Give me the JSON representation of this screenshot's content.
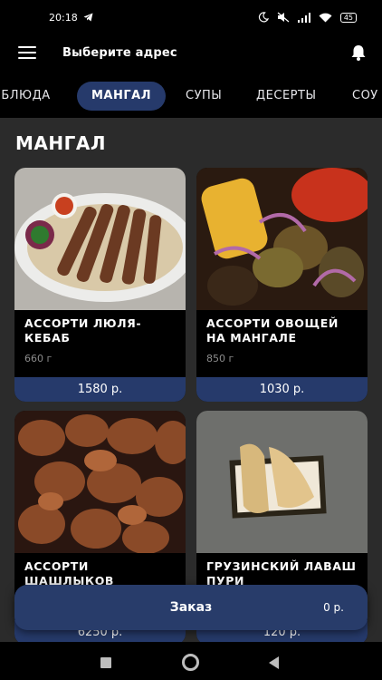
{
  "status": {
    "time": "20:18",
    "battery": "45"
  },
  "header": {
    "address_label": "Выберите адрес"
  },
  "tabs": [
    {
      "label": "Е БЛЮДА"
    },
    {
      "label": "МАНГАЛ"
    },
    {
      "label": "СУПЫ"
    },
    {
      "label": "ДЕСЕРТЫ"
    },
    {
      "label": "СОУ"
    }
  ],
  "section": {
    "title": "МАНГАЛ"
  },
  "products": [
    {
      "name": "АССОРТИ ЛЮЛЯ-КЕБАБ",
      "weight": "660 г",
      "price": "1580 р."
    },
    {
      "name": "АССОРТИ ОВОЩЕЙ НА МАНГАЛЕ",
      "weight": "850 г",
      "price": "1030 р."
    },
    {
      "name": "АССОРТИ ШАШЛЫКОВ",
      "weight": "",
      "price": "6250 р."
    },
    {
      "name": "ГРУЗИНСКИЙ ЛАВАШ ПУРИ",
      "weight": "",
      "price": "120 р."
    }
  ],
  "order": {
    "label": "Заказ",
    "total": "0 р."
  },
  "colors": {
    "accent": "#263a6b",
    "background": "#2b2b2b",
    "card": "#000000"
  }
}
